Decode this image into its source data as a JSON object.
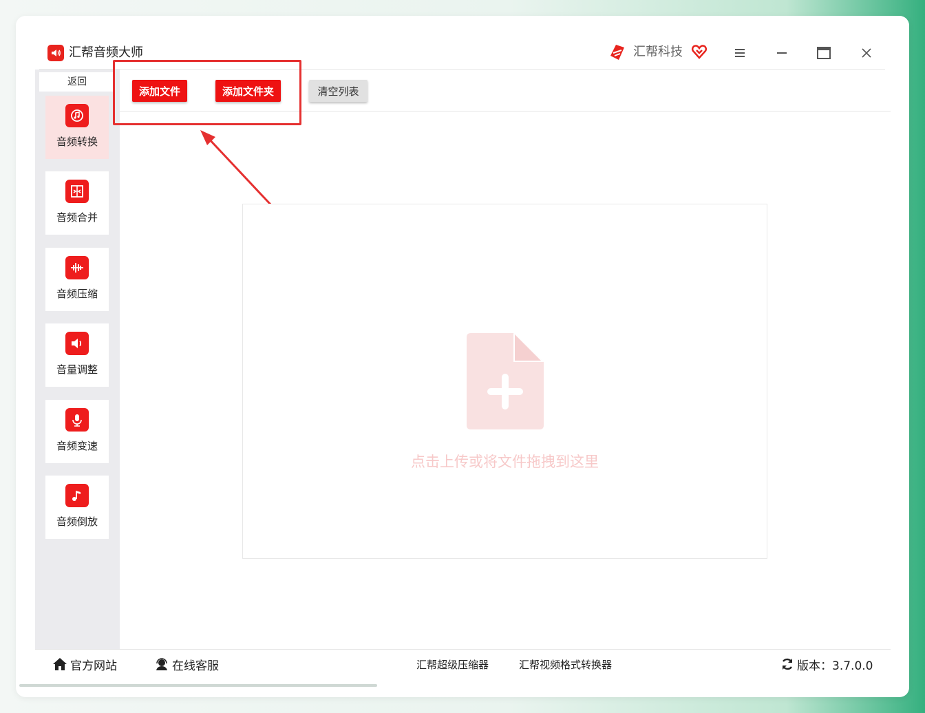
{
  "app": {
    "title": "汇帮音频大师",
    "brand": "汇帮科技",
    "accent_color": "#ee1212"
  },
  "window_controls": {
    "menu_icon": "hamburger-icon",
    "minimize_icon": "minimize-icon",
    "maximize_icon": "maximize-icon",
    "close_icon": "close-icon"
  },
  "sidebar": {
    "back_label": "返回",
    "items": [
      {
        "label": "音频转换",
        "icon": "audio-convert-icon",
        "active": true
      },
      {
        "label": "音频合并",
        "icon": "audio-merge-icon",
        "active": false
      },
      {
        "label": "音频压缩",
        "icon": "audio-compress-icon",
        "active": false
      },
      {
        "label": "音量调整",
        "icon": "volume-icon",
        "active": false
      },
      {
        "label": "音频变速",
        "icon": "microphone-icon",
        "active": false
      },
      {
        "label": "音频倒放",
        "icon": "music-note-icon",
        "active": false
      }
    ]
  },
  "toolbar": {
    "add_file": "添加文件",
    "add_folder": "添加文件夹",
    "clear_list": "清空列表"
  },
  "dropzone": {
    "text": "点击上传或将文件拖拽到这里",
    "icon": "file-add-icon"
  },
  "footer": {
    "website": "官方网站",
    "support": "在线客服",
    "compressor": "汇帮超级压缩器",
    "video_converter": "汇帮视频格式转换器",
    "version": "版本：3.7.0.0"
  }
}
